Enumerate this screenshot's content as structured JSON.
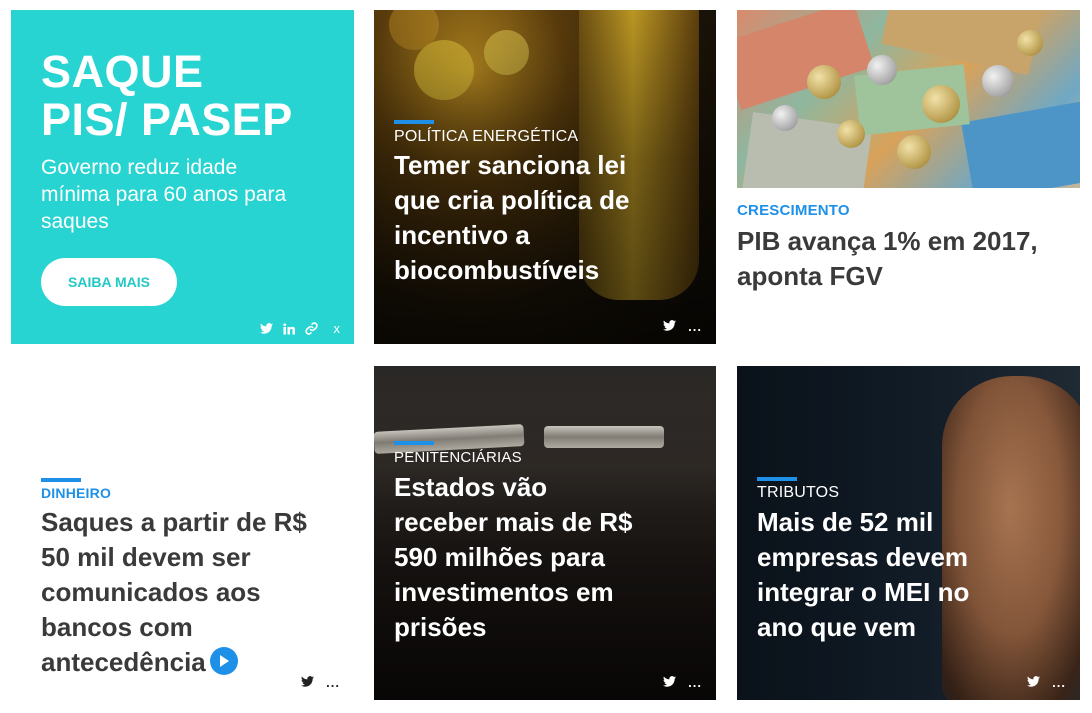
{
  "promo": {
    "title_line1": "SAQUE",
    "title_line2": "PIS/ PASEP",
    "subtitle": "Governo reduz idade mínima para 60 anos para saques",
    "button": "SAIBA MAIS",
    "close": "x"
  },
  "cards": [
    {
      "category": "POLÍTICA ENERGÉTICA",
      "headline": "Temer sanciona lei que cria política de incentivo a biocombustíveis"
    },
    {
      "category": "CRESCIMENTO",
      "headline": "PIB avança 1% em 2017, aponta FGV"
    },
    {
      "category": "DINHEIRO",
      "headline": "Saques a partir de R$ 50 mil devem ser comunicados aos bancos com antecedência"
    },
    {
      "category": "PENITENCIÁRIAS",
      "headline": "Estados vão receber mais de R$ 590 milhões para investimentos em prisões"
    },
    {
      "category": "TRIBUTOS",
      "headline": "Mais de 52 mil empresas devem integrar o MEI no ano que vem"
    }
  ],
  "more_label": "...",
  "icons": {
    "twitter": "twitter-icon",
    "linkedin": "linkedin-icon",
    "link": "link-icon",
    "more": "more-icon",
    "play": "play-icon"
  },
  "colors": {
    "promo_bg": "#27d4d1",
    "accent": "#1e90e8",
    "headline_dark": "#3a3a3a",
    "white": "#ffffff"
  }
}
